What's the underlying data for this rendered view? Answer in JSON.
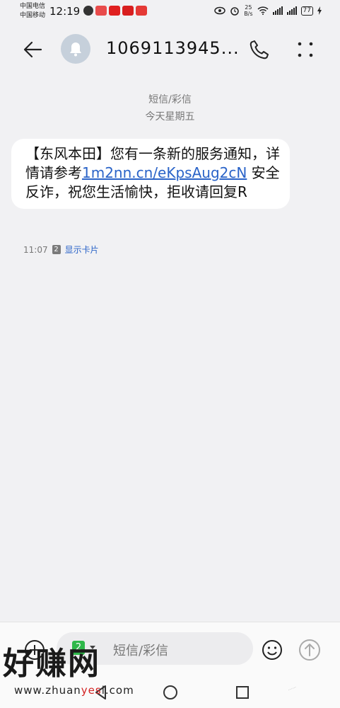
{
  "status_bar": {
    "carrier1": "中国电信",
    "carrier2": "中国移动",
    "time": "12:19",
    "speed_value": "25",
    "speed_unit": "B/s",
    "battery": "77"
  },
  "header": {
    "title": "1069113945..."
  },
  "conversation": {
    "channel_label": "短信/彩信",
    "date_label": "今天星期五"
  },
  "message": {
    "text_before_link": "【东风本田】您有一条新的服务通知，详情请参考",
    "link_text": "1m2nn.cn/eKpsAug2cN",
    "text_after_link": " 安全反诈，祝您生活愉快，拒收请回复R",
    "time": "11:07",
    "sim_slot": "2",
    "show_card_label": "显示卡片"
  },
  "composer": {
    "sim_slot": "2",
    "placeholder": "短信/彩信"
  },
  "watermark": {
    "brand": "好赚网",
    "url_prefix": "www.zhuan",
    "url_highlight": "yes",
    "url_suffix": "l.com",
    "faint_text": "……"
  },
  "colors": {
    "background": "#f1f1f3",
    "link": "#2a63c8",
    "sim_green": "#2fb84a"
  }
}
